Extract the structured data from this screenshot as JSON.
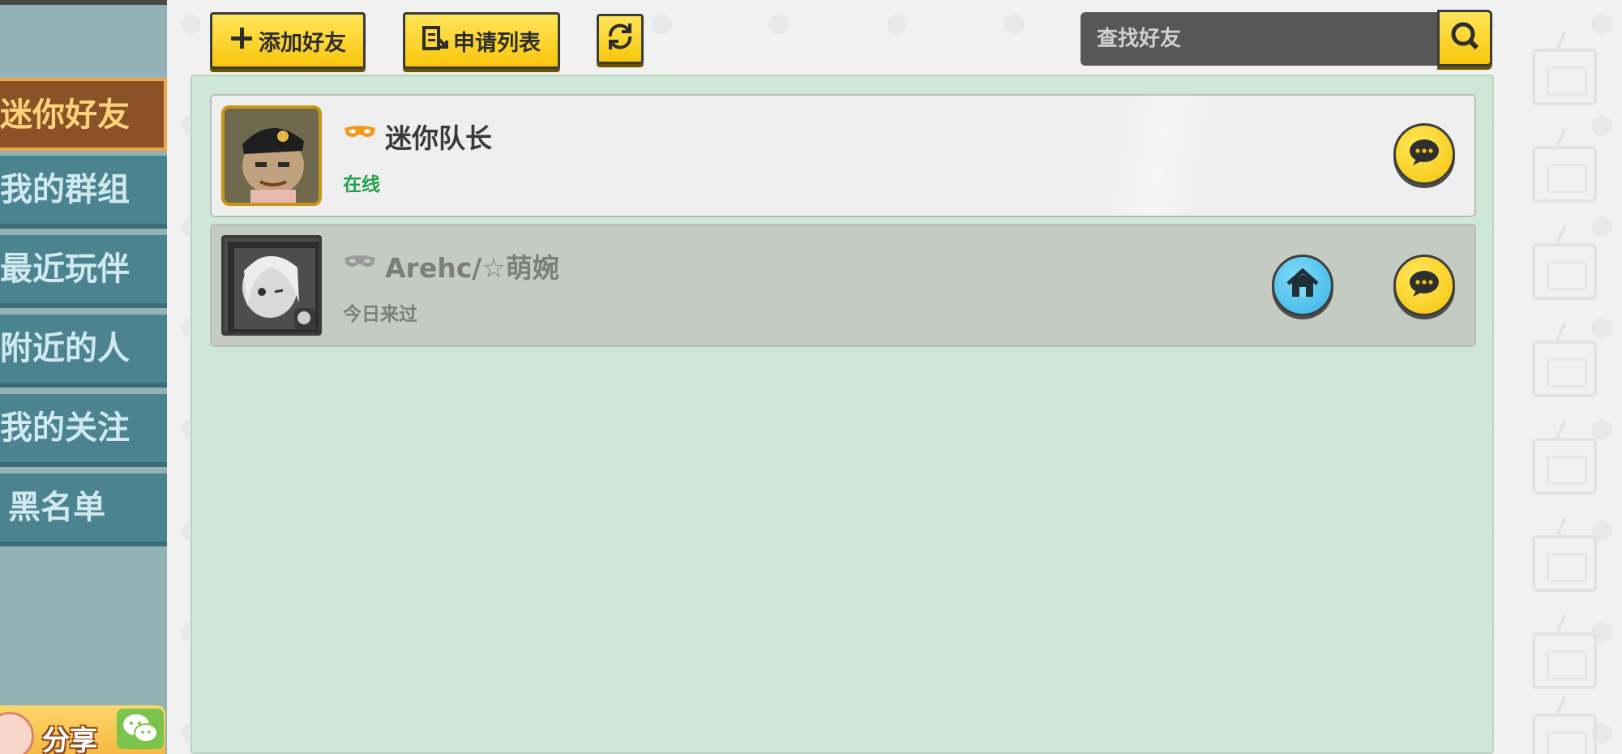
{
  "toolbar": {
    "add_friend_label": "添加好友",
    "request_list_label": "申请列表",
    "search_placeholder": "查找好友"
  },
  "sidebar": {
    "items": [
      {
        "label": "迷你好友",
        "active": true
      },
      {
        "label": "我的群组",
        "active": false
      },
      {
        "label": "最近玩伴",
        "active": false
      },
      {
        "label": "附近的人",
        "active": false
      },
      {
        "label": "我的关注",
        "active": false
      },
      {
        "label": "黑名单",
        "active": false
      }
    ],
    "share_label": "分享"
  },
  "friends": [
    {
      "name": "迷你队长",
      "status": "在线",
      "online": true
    },
    {
      "name": "Arehc/☆萌婉",
      "status": "今日来过",
      "online": false
    }
  ],
  "colors": {
    "accent_yellow": "#f9c60c",
    "online_green": "#22a14a",
    "panel_green": "#cfe7d7",
    "sidebar_teal": "#4c8391",
    "sidebar_active": "#8c5227",
    "home_blue": "#38b3e6"
  },
  "icons": {
    "add": "plus-icon",
    "request_list": "list-icon",
    "refresh": "refresh-icon",
    "search": "search-icon",
    "chat": "chat-bubble-icon",
    "home": "home-icon",
    "mask": "mask-icon",
    "wechat": "wechat-icon"
  }
}
